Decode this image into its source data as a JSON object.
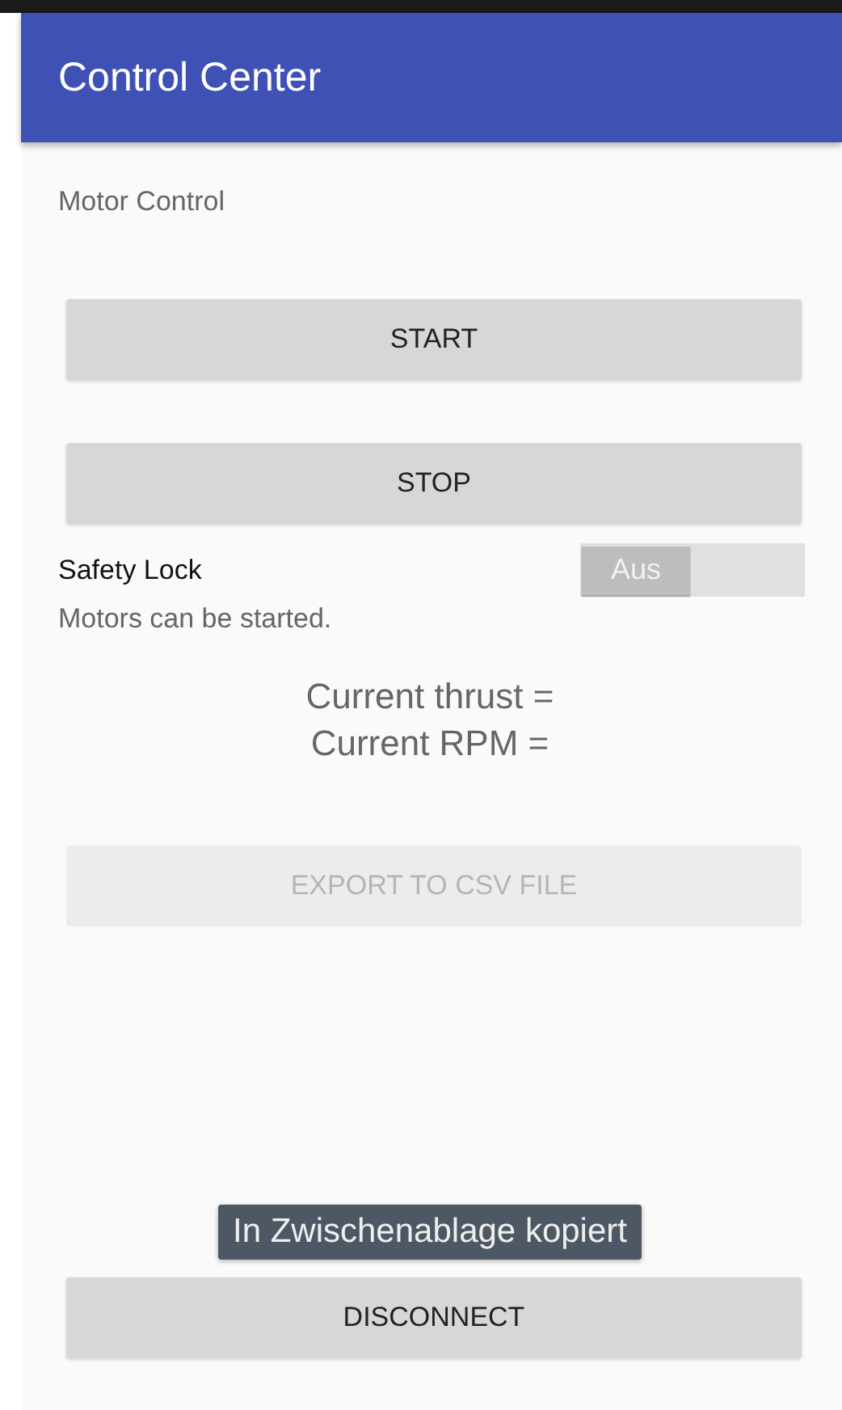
{
  "app_bar": {
    "title": "Control Center"
  },
  "section_label": "Motor Control",
  "motor_buttons": [
    {
      "label": "START",
      "disabled": false
    },
    {
      "label": "STOP",
      "disabled": false
    }
  ],
  "safety_lock": {
    "label": "Safety Lock",
    "on": false,
    "switch_text": "Aus"
  },
  "status": "Motors can be started.",
  "readings": [
    "Current thrust =",
    "Current RPM ="
  ],
  "export_button": {
    "label": "EXPORT TO CSV FILE",
    "disabled": true
  },
  "toast": "In Zwischenablage kopiert",
  "disconnect_button": {
    "label": "DISCONNECT",
    "disabled": false
  }
}
